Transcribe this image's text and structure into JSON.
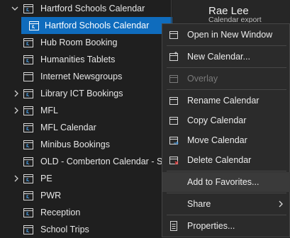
{
  "folders": [
    {
      "label": "Hartford Schools Calendar",
      "expanded": true
    },
    {
      "label": "Hartford Schools Calendar",
      "selected": true
    },
    {
      "label": "Hub Room Booking"
    },
    {
      "label": "Humanities Tablets"
    },
    {
      "label": "Internet Newsgroups"
    },
    {
      "label": "Library ICT Bookings",
      "expandable": true
    },
    {
      "label": "MFL",
      "expandable": true
    },
    {
      "label": "MFL Calendar"
    },
    {
      "label": "Minibus Bookings"
    },
    {
      "label": "OLD - Comberton Calendar - S..."
    },
    {
      "label": "PE",
      "expandable": true
    },
    {
      "label": "PWR"
    },
    {
      "label": "Reception"
    },
    {
      "label": "School Trips"
    }
  ],
  "right_pane": {
    "name": "Rae Lee",
    "subtitle": "Calendar export"
  },
  "context_menu": {
    "items": [
      {
        "label": "Open in New Window",
        "icon": "new-window-icon"
      },
      {
        "label": "New Calendar...",
        "icon": "new-calendar-icon"
      },
      {
        "label": "Overlay",
        "icon": "overlay-icon",
        "disabled": true
      },
      {
        "label": "Rename Calendar",
        "icon": "rename-calendar-icon"
      },
      {
        "label": "Copy Calendar",
        "icon": "copy-calendar-icon"
      },
      {
        "label": "Move Calendar",
        "icon": "move-calendar-icon"
      },
      {
        "label": "Delete Calendar",
        "icon": "delete-calendar-icon"
      },
      {
        "label": "Add to Favorites...",
        "highlighted": true
      },
      {
        "label": "Share",
        "has_submenu": true
      },
      {
        "label": "Properties...",
        "icon": "properties-icon"
      }
    ]
  },
  "colors": {
    "selection": "#0f6cbd",
    "background": "#1f1f1f",
    "menu": "#2b2b2b"
  }
}
